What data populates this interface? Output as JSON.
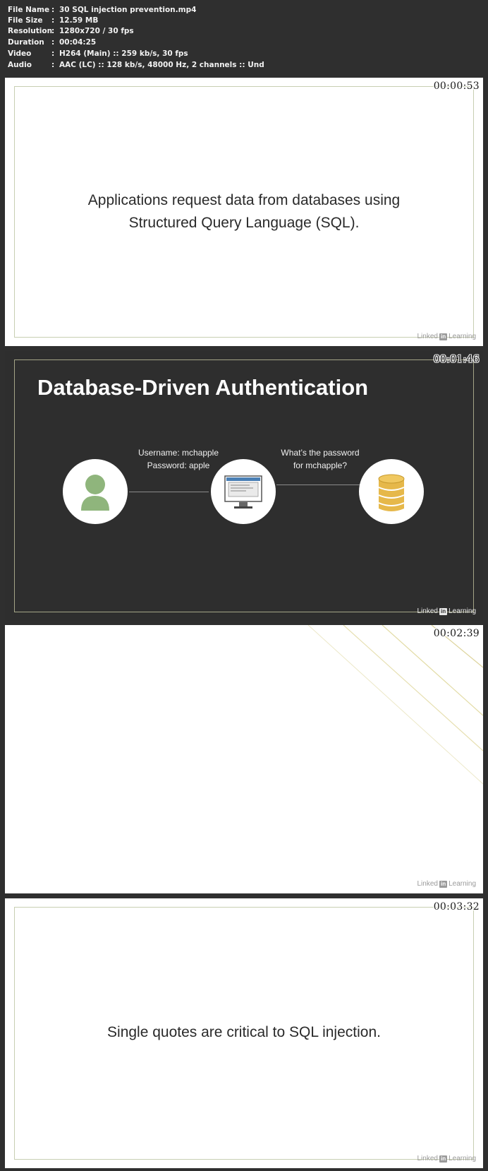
{
  "file_info": [
    {
      "key": "File Name",
      "value": "30 SQL injection prevention.mp4"
    },
    {
      "key": "File Size",
      "value": "12.59 MB"
    },
    {
      "key": "Resolution",
      "value": "1280x720 / 30 fps"
    },
    {
      "key": "Duration",
      "value": "00:04:25"
    },
    {
      "key": "Video",
      "value": "H264 (Main) :: 259 kb/s, 30 fps"
    },
    {
      "key": "Audio",
      "value": "AAC (LC) :: 128 kb/s, 48000 Hz, 2 channels :: Und"
    }
  ],
  "separator": ":",
  "watermark": {
    "brand_before": "Linked",
    "brand_box": "in",
    "brand_after": "Learning"
  },
  "frames": [
    {
      "timestamp": "00:00:53",
      "text_line1": "Applications request data from databases using",
      "text_line2": "Structured Query Language (SQL)."
    },
    {
      "timestamp": "00:01:46",
      "title": "Database-Driven Authentication",
      "label_left_line1": "Username: mchapple",
      "label_left_line2": "Password: apple",
      "label_right_line1": "What’s the password",
      "label_right_line2": "for mchapple?",
      "icons": [
        "user-icon",
        "computer-icon",
        "database-icon"
      ],
      "colors": {
        "user": "#8fb57c",
        "database": "#e6b84a",
        "screen": "#4a7fb5"
      }
    },
    {
      "timestamp": "00:02:39"
    },
    {
      "timestamp": "00:03:32",
      "text": "Single quotes are critical to SQL injection."
    }
  ]
}
